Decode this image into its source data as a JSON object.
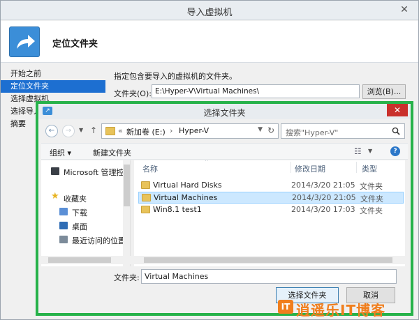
{
  "wizard": {
    "title": "导入虚拟机",
    "close_glyph": "✕",
    "header_title": "定位文件夹",
    "nav": [
      "开始之前",
      "定位文件夹",
      "选择虚拟机",
      "选择导入类型",
      "摘要"
    ],
    "instruction": "指定包含要导入的虚拟机的文件夹。",
    "folder_label": "文件夹(O):",
    "folder_value": "E:\\Hyper-V\\Virtual Machines\\",
    "browse_label": "浏览(B)..."
  },
  "dialog": {
    "title": "选择文件夹",
    "close_glyph": "✕",
    "address": {
      "chevron": "«",
      "segment1": "新加卷 (E:)",
      "separator": "›",
      "segment2": "Hyper-V"
    },
    "search_placeholder": "搜索\"Hyper-V\"",
    "toolbar": {
      "organize": "组织 ▾",
      "new_folder": "新建文件夹"
    },
    "nav_pane": [
      {
        "label": "Microsoft 管理控制台",
        "icon": "console-icon"
      },
      {
        "label": "收藏夹",
        "icon": "star-icon"
      },
      {
        "label": "下载",
        "icon": "download-folder-icon"
      },
      {
        "label": "桌面",
        "icon": "desktop-icon"
      },
      {
        "label": "最近访问的位置",
        "icon": "recent-places-icon"
      }
    ],
    "columns": {
      "name": "名称",
      "date": "修改日期",
      "type": "类型"
    },
    "files": [
      {
        "name": "Virtual Hard Disks",
        "date": "2014/3/20 21:05",
        "type": "文件夹"
      },
      {
        "name": "Virtual Machines",
        "date": "2014/3/20 21:05",
        "type": "文件夹"
      },
      {
        "name": "Win8.1 test1",
        "date": "2014/3/20 17:03",
        "type": "文件夹"
      }
    ],
    "folder_field_label": "文件夹:",
    "folder_field_value": "Virtual Machines",
    "select_button": "选择文件夹",
    "cancel_button": "取消"
  },
  "watermark": {
    "badge": "IT",
    "text": "逍遥乐IT博客"
  },
  "colors": {
    "accent": "#27b24a",
    "selection": "#cce8ff",
    "close_red": "#c9302c",
    "watermark": "#f07e1d"
  }
}
